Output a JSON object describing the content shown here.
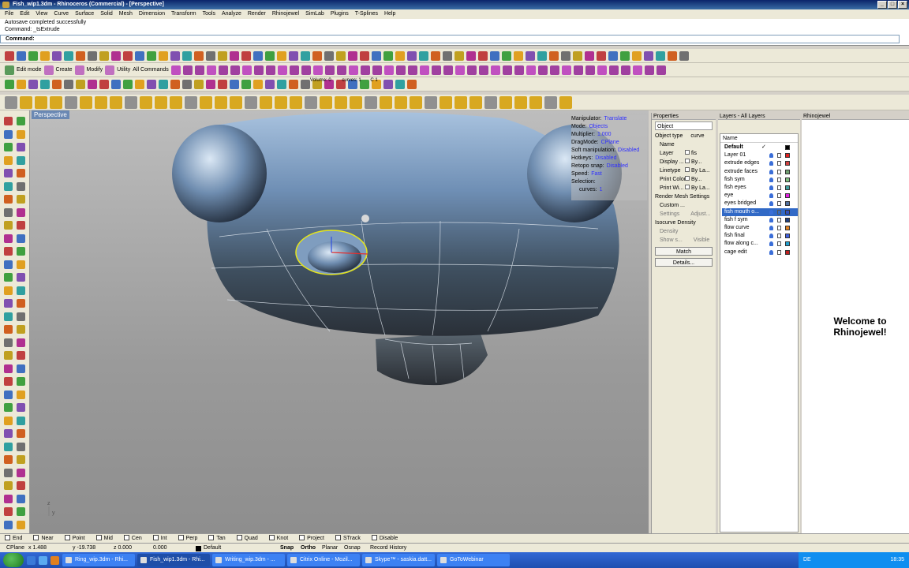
{
  "window": {
    "title": "Fish_wip1.3dm - Rhinoceros (Commercial) - [Perspective]",
    "min": "_",
    "max": "□",
    "close": "×"
  },
  "menu": [
    "File",
    "Edit",
    "View",
    "Curve",
    "Surface",
    "Solid",
    "Mesh",
    "Dimension",
    "Transform",
    "Tools",
    "Analyze",
    "Render",
    "Rhinojewel",
    "SimLab",
    "Plugins",
    "T-Splines",
    "Help"
  ],
  "command": {
    "history1": "Autosave completed successfully",
    "history2": "Command: _tsExtrude",
    "prompt": "Command:"
  },
  "tsplines_bar": {
    "edit_mode": "Edit mode",
    "create": "Create",
    "modify": "Modify",
    "utility": "Utility",
    "all_commands": "All Commands"
  },
  "selection_info": {
    "volume": "Volume: 0",
    "curves": "curves: 1",
    "c": "C 1"
  },
  "viewport": {
    "title": "Perspective",
    "axis_z": "z",
    "axis_y": "y"
  },
  "manipulator": [
    {
      "k": "Manipulator:",
      "v": "Translate"
    },
    {
      "k": "Mode:",
      "v": "Objects"
    },
    {
      "k": "Multiplier:",
      "v": "1.000"
    },
    {
      "k": "DragMode:",
      "v": "CPlane"
    },
    {
      "k": "Soft manipulation:",
      "v": "Disabled"
    },
    {
      "k": "Hotkeys:",
      "v": "Disabled"
    },
    {
      "k": "Retopo snap:",
      "v": "Disabled"
    },
    {
      "k": "Speed:",
      "v": "Fast"
    },
    {
      "k": "Selection:",
      "v": ""
    },
    {
      "k": "curves:",
      "v": "1"
    }
  ],
  "properties": {
    "header": "Properties",
    "dropdown": "Object",
    "object_type_label": "Object type",
    "object_type": "curve",
    "name_label": "Name",
    "rows": [
      {
        "label": "Layer",
        "value": "fis"
      },
      {
        "label": "Display ...",
        "value": "By..."
      },
      {
        "label": "Linetype",
        "value": "By La..."
      },
      {
        "label": "Print Color",
        "value": "By..."
      },
      {
        "label": "Print Wi...",
        "value": "By La..."
      }
    ],
    "render_mesh": "Render Mesh Settings",
    "custom": "Custom ...",
    "settings": "Settings",
    "adjust": "Adjust...",
    "isocurve": "Isocurve Density",
    "density": "Density",
    "show": "Show s...",
    "visible": "Visible",
    "match": "Match",
    "details": "Details..."
  },
  "layers": {
    "header": "Layers - All Layers",
    "col_name": "Name",
    "items": [
      {
        "name": "Default",
        "color": "#000000",
        "bold": true,
        "check": "✓"
      },
      {
        "name": "Layer 01",
        "color": "#e02020"
      },
      {
        "name": "extrude edges",
        "color": "#d04040"
      },
      {
        "name": "extrude faces",
        "color": "#70a070"
      },
      {
        "name": "fish sym",
        "color": "#80c080"
      },
      {
        "name": "fish eyes",
        "color": "#40a0a0"
      },
      {
        "name": "eye",
        "color": "#e020e0"
      },
      {
        "name": "eyes bridged",
        "color": "#5070a0"
      },
      {
        "name": "fish mouth o...",
        "color": "#3050c0",
        "selected": true
      },
      {
        "name": "fish f sym",
        "color": "#204080"
      },
      {
        "name": "flow curve",
        "color": "#e08020"
      },
      {
        "name": "fish final",
        "color": "#4060e0"
      },
      {
        "name": "flow along c...",
        "color": "#20a0d0"
      },
      {
        "name": "cage edit",
        "color": "#c02020"
      }
    ]
  },
  "rhinojewel": {
    "header": "Rhinojewel",
    "welcome": "Welcome to Rhinojewel!"
  },
  "snaps": [
    "End",
    "Near",
    "Point",
    "Mid",
    "Cen",
    "Int",
    "Perp",
    "Tan",
    "Quad",
    "Knot",
    "Project",
    "STrack",
    "Disable"
  ],
  "status": {
    "cplane": "CPlane",
    "x": "x 1.488",
    "y": "y -19.738",
    "z": "z 0.000",
    "d": "0.000",
    "layer": "Default",
    "snap": "Snap",
    "ortho": "Ortho",
    "planar": "Planar",
    "osnap": "Osnap",
    "history": "Record History"
  },
  "taskbar": {
    "tasks": [
      "Ring_wip.3dm - Rhi...",
      "Fish_wip1.3dm - Rhi...",
      "Writing_wip.3dm - ...",
      "Citrix Online - Mozil...",
      "Skype™ - saskia.datt...",
      "GoToWebinar"
    ],
    "lang": "DE",
    "clock": "18:35"
  },
  "colors": {
    "accent": "#0a246a",
    "selected_layer": "#3169c6",
    "viewport_bg": "#a8a8a8"
  }
}
